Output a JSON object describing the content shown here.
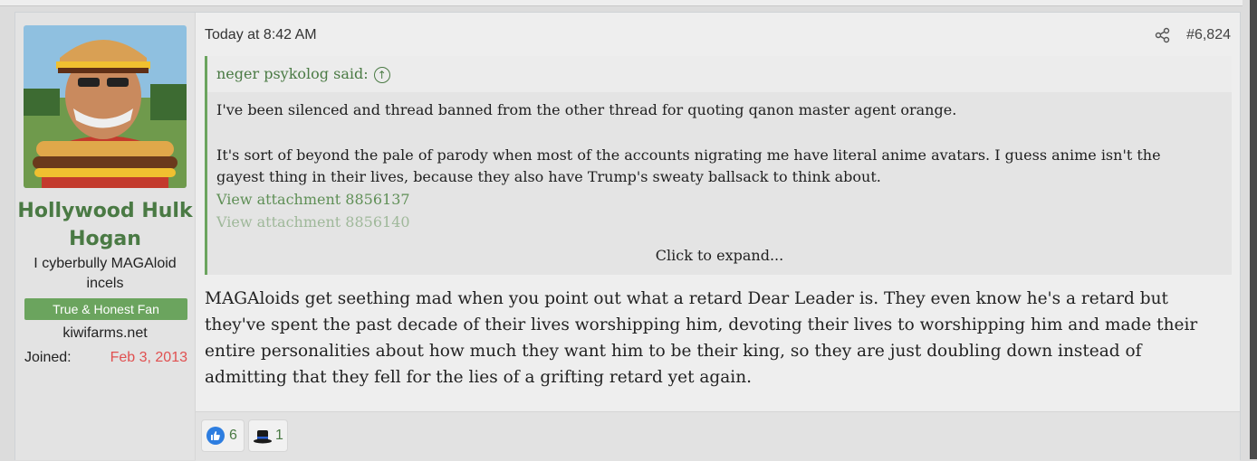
{
  "post": {
    "user": {
      "name": "Hollywood Hulk Hogan",
      "title": "I cyberbully MAGAloid incels",
      "banner": "True & Honest Fan",
      "site": "kiwifarms.net",
      "joined_label": "Joined:",
      "joined_date": "Feb 3, 2013"
    },
    "timestamp": "Today at 8:42 AM",
    "number": "#6,824",
    "quote": {
      "author": "neger psykolog said:",
      "line1": "I've been silenced and thread banned from the other thread for quoting qanon master agent orange.",
      "line2": "It's sort of beyond the pale of parody when most of the accounts nigrating me have literal anime avatars. I guess anime isn't the gayest thing in their lives, because they also have Trump's sweaty ballsack to think about.",
      "attachment1": "View attachment 8856137",
      "attachment2": "View attachment 8856140",
      "expand": "Click to expand..."
    },
    "body": "MAGAloids get seething mad when you point out what a retard Dear Leader is. They even know he's a retard but they've spent the past decade of their lives worshipping him, devoting their lives to worshipping him and made their entire personalities about how much they want him to be their king, so they are just doubling down instead of admitting that they fell for the lies of a grifting retard yet again.",
    "reactions": [
      {
        "icon": "thumbs-up-icon",
        "count": "6"
      },
      {
        "icon": "top-hat-icon",
        "count": "1"
      }
    ]
  }
}
